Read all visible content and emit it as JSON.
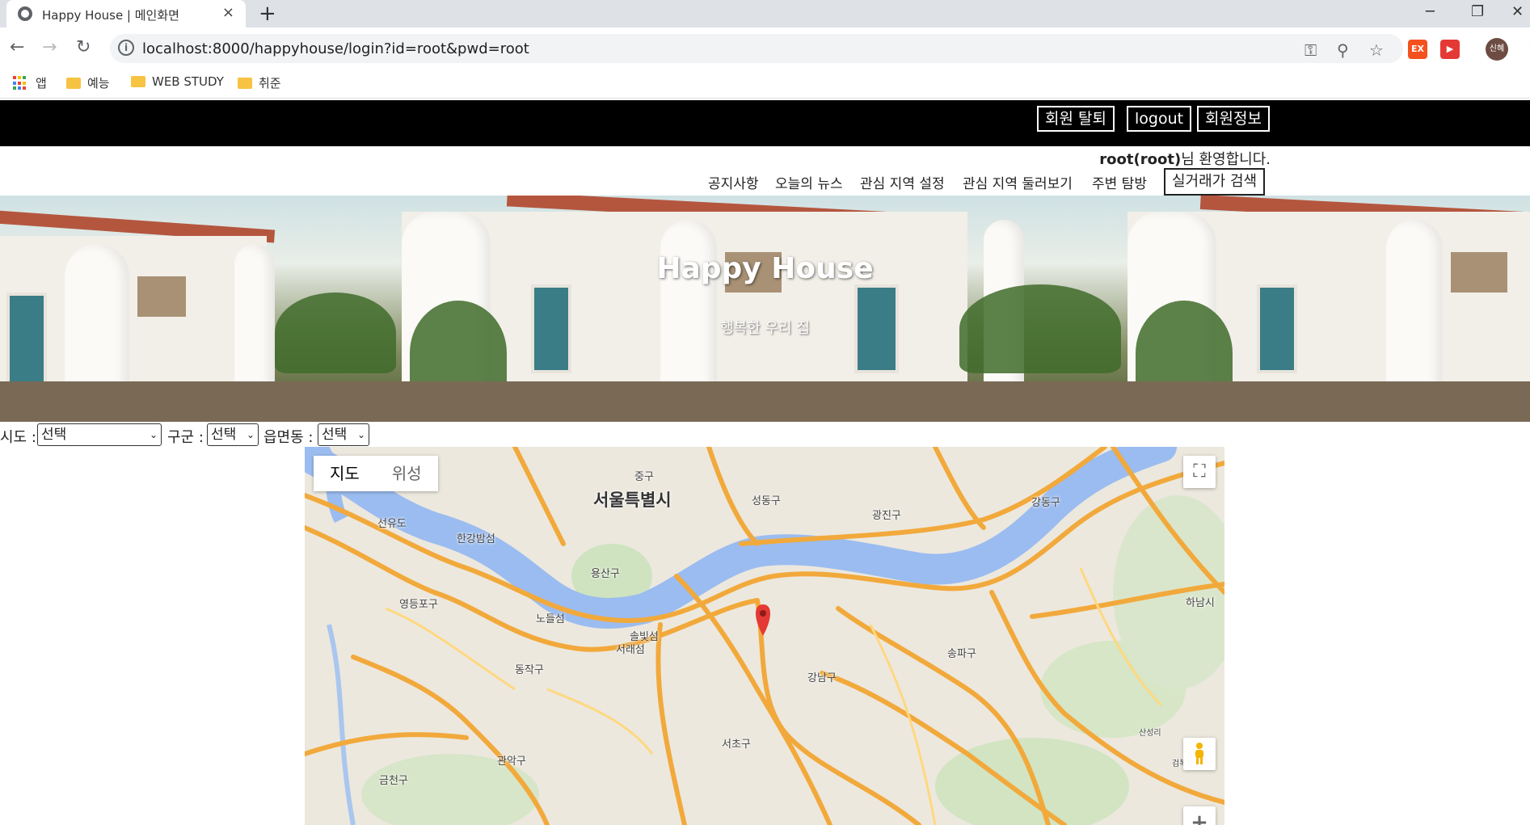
{
  "browser": {
    "tab_title": "Happy House | 메인화면",
    "tab_close": "×",
    "new_tab": "+",
    "url": "localhost:8000/happyhouse/login?id=root&pwd=root",
    "window": {
      "minimize": "─",
      "maximize": "❐",
      "close": "✕"
    },
    "avatar_label": "신혜",
    "ext1_label": "EX",
    "ext2_label": "▶",
    "bookmarks": [
      {
        "label": "앱",
        "icon": "apps-grid-icon"
      },
      {
        "label": "예능",
        "icon": "folder-icon"
      },
      {
        "label": "WEB STUDY",
        "icon": "folder-icon"
      },
      {
        "label": "취준",
        "icon": "folder-icon"
      }
    ]
  },
  "header": {
    "buttons": [
      {
        "label": "회원 탈퇴"
      },
      {
        "label": "logout"
      },
      {
        "label": "회원정보"
      }
    ],
    "welcome_user": "root(root)",
    "welcome_suffix": "님 환영합니다.",
    "nav": [
      {
        "label": "공지사항"
      },
      {
        "label": "오늘의 뉴스"
      },
      {
        "label": "관심 지역 설정"
      },
      {
        "label": "관심 지역 둘러보기"
      },
      {
        "label": "주변 탐방"
      },
      {
        "label": "실거래가 검색"
      }
    ]
  },
  "hero": {
    "title": "Happy House",
    "subtitle": "행복한 우리 집"
  },
  "filters": {
    "sido_label": "시도 :",
    "sido_value": "선택",
    "gugun_label": "구군 :",
    "gugun_value": "선택",
    "dong_label": "읍면동 :",
    "dong_value": "선택"
  },
  "map": {
    "type_map": "지도",
    "type_satellite": "위성",
    "labels": [
      {
        "text": "중구"
      },
      {
        "text": "서울특별시"
      },
      {
        "text": "성동구"
      },
      {
        "text": "광진구"
      },
      {
        "text": "강동구"
      },
      {
        "text": "선유도"
      },
      {
        "text": "한강밤섬"
      },
      {
        "text": "용산구"
      },
      {
        "text": "영등포구"
      },
      {
        "text": "노들섬"
      },
      {
        "text": "하남시"
      },
      {
        "text": "솔빛섬"
      },
      {
        "text": "서래섬"
      },
      {
        "text": "송파구"
      },
      {
        "text": "동작구"
      },
      {
        "text": "강남구"
      },
      {
        "text": "서초구"
      },
      {
        "text": "관악구"
      },
      {
        "text": "금천구"
      },
      {
        "text": "산성리"
      },
      {
        "text": "검복리"
      }
    ],
    "zoom_in": "+"
  }
}
